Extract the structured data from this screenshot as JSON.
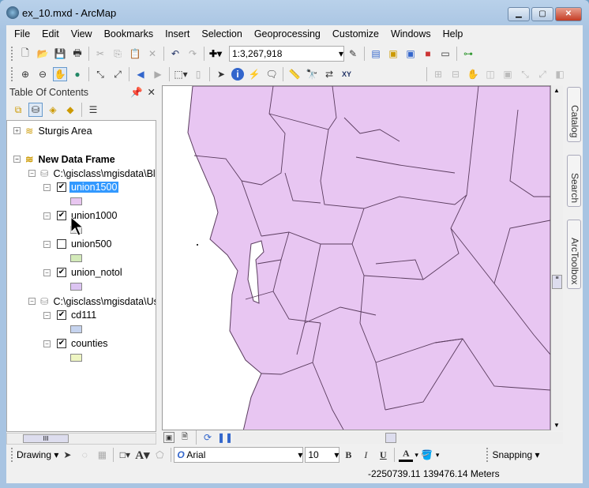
{
  "window": {
    "title": "ex_10.mxd - ArcMap"
  },
  "menu": [
    "File",
    "Edit",
    "View",
    "Bookmarks",
    "Insert",
    "Selection",
    "Geoprocessing",
    "Customize",
    "Windows",
    "Help"
  ],
  "standard_toolbar": {
    "scale": "1:3,267,918"
  },
  "toc": {
    "title": "Table Of Contents",
    "frames": [
      {
        "name": "Sturgis Area"
      },
      {
        "name": "New Data Frame"
      }
    ],
    "sources": [
      "C:\\gisclass\\mgisdata\\Bl",
      "C:\\gisclass\\mgisdata\\Us"
    ],
    "layers": [
      {
        "name": "union1500",
        "checked": true,
        "selected": true,
        "color": "#e8c6f0"
      },
      {
        "name": "union1000",
        "checked": true,
        "color": "#e6e6e6"
      },
      {
        "name": "union500",
        "checked": false,
        "color": "#d3eab9"
      },
      {
        "name": "union_notol",
        "checked": true,
        "color": "#dcc4f2"
      },
      {
        "name": "cd111",
        "checked": true,
        "color": "#c5d3ee"
      },
      {
        "name": "counties",
        "checked": true,
        "color": "#eef5c2"
      }
    ]
  },
  "side_tabs": [
    "Catalog",
    "Search",
    "ArcToolbox"
  ],
  "drawing_toolbar": {
    "label": "Drawing",
    "font": "Arial",
    "size": "10",
    "bold": "B",
    "italic": "I",
    "underline": "U",
    "font_color": "A",
    "snapping": "Snapping"
  },
  "status": {
    "coords": "-2250739.11  139476.14 Meters"
  },
  "colors": {
    "map_fill": "#e8c6f2",
    "selection": "#3399ff"
  }
}
